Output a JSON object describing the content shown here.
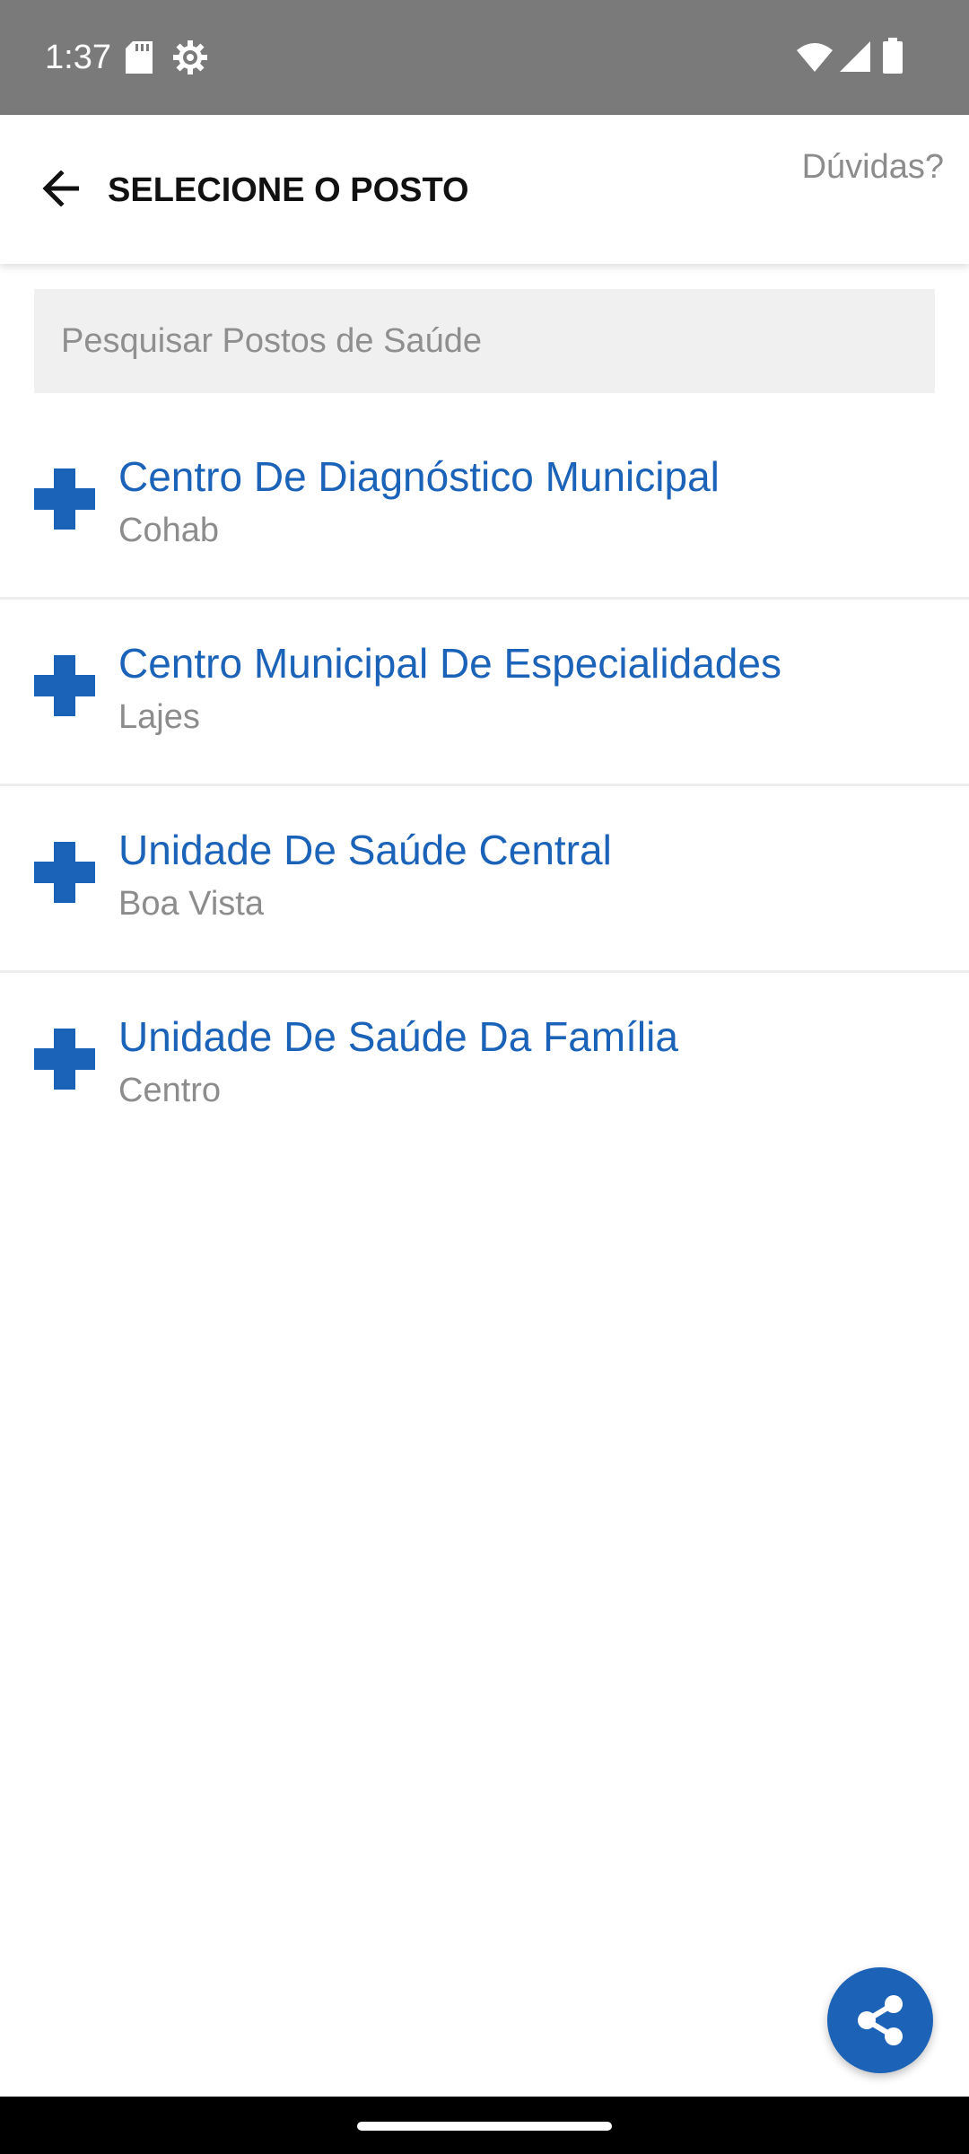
{
  "status_bar": {
    "time": "1:37",
    "icons": [
      "sd-card-icon",
      "gear-icon",
      "wifi-icon",
      "signal-icon",
      "battery-icon"
    ]
  },
  "app_bar": {
    "title": "SELECIONE O POSTO",
    "help": "Dúvidas?"
  },
  "search": {
    "placeholder": "Pesquisar Postos de Saúde"
  },
  "postos": [
    {
      "name": "Centro De Diagnóstico Municipal",
      "neighborhood": "Cohab"
    },
    {
      "name": "Centro Municipal De Especialidades",
      "neighborhood": "Lajes"
    },
    {
      "name": "Unidade De Saúde Central",
      "neighborhood": "Boa Vista"
    },
    {
      "name": "Unidade De Saúde Da Família",
      "neighborhood": "Centro"
    }
  ],
  "colors": {
    "accent": "#1a63b8",
    "status_bar": "#7a7a7a",
    "muted_text": "#8c8c8c"
  }
}
